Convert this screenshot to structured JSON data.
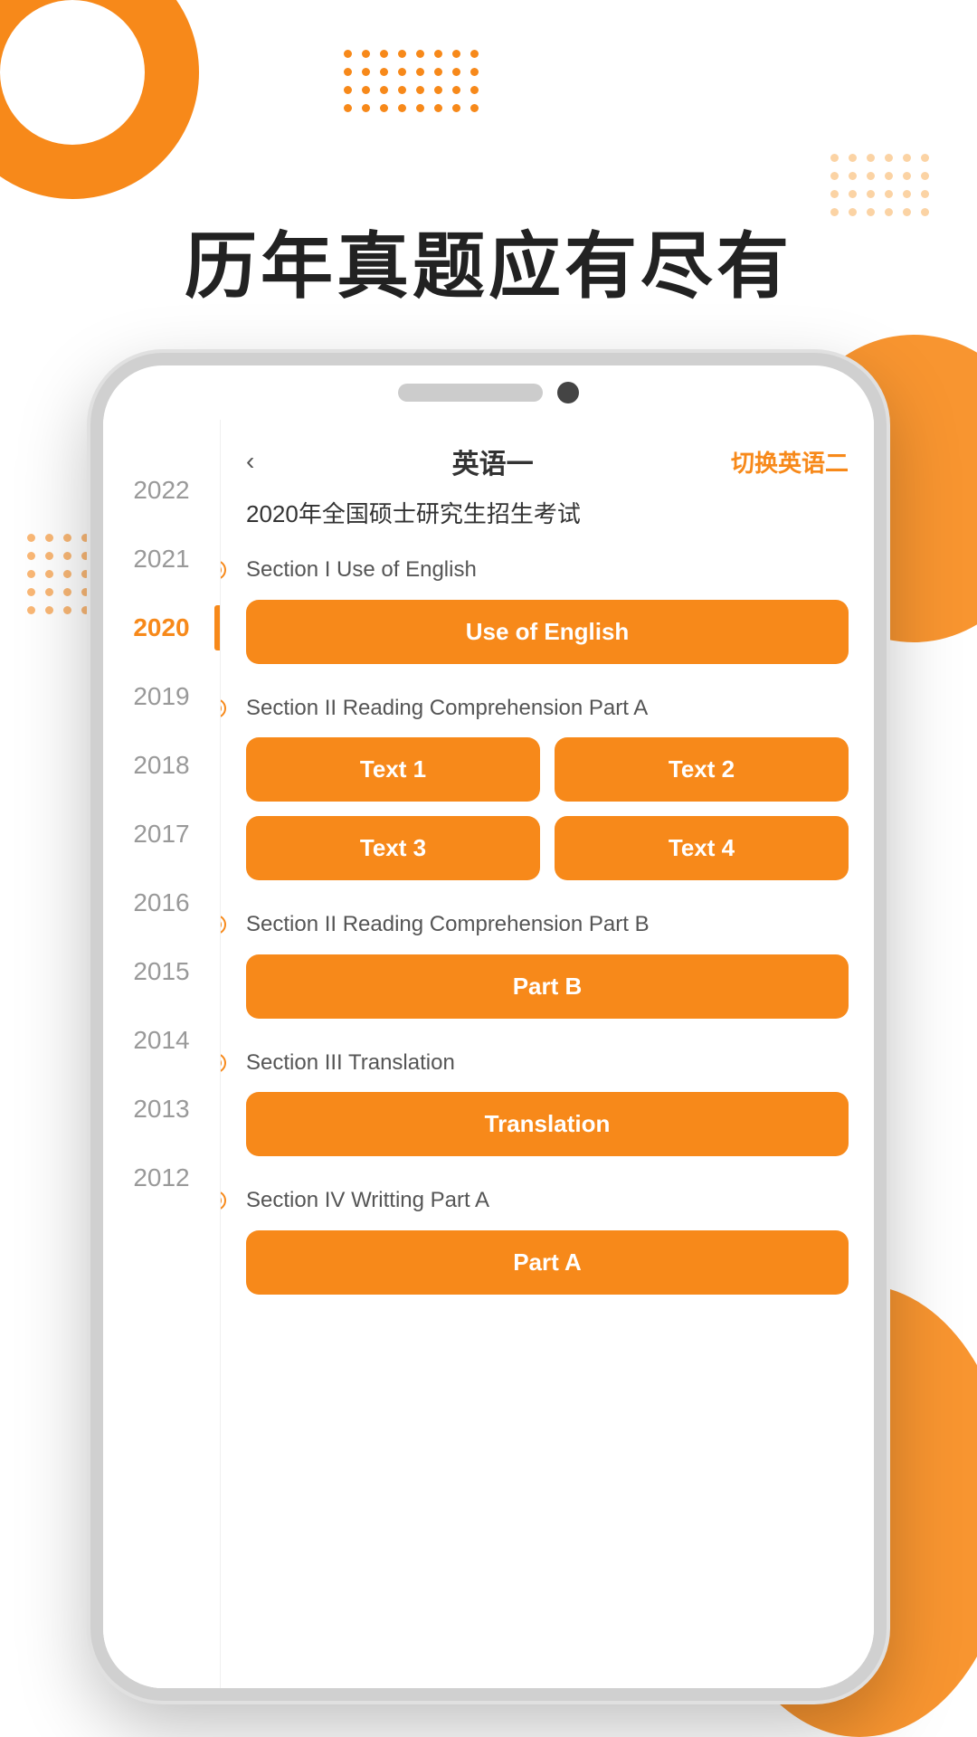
{
  "page": {
    "heading": "历年真题应有尽有"
  },
  "header": {
    "back_label": "‹",
    "lang_title": "英语一",
    "lang_switch": "切换英语二"
  },
  "exam": {
    "title": "2020年全国硕士研究生招生考试"
  },
  "years": [
    {
      "label": "2022",
      "active": false
    },
    {
      "label": "2021",
      "active": false
    },
    {
      "label": "2020",
      "active": true
    },
    {
      "label": "2019",
      "active": false
    },
    {
      "label": "2018",
      "active": false
    },
    {
      "label": "2017",
      "active": false
    },
    {
      "label": "2016",
      "active": false
    },
    {
      "label": "2015",
      "active": false
    },
    {
      "label": "2014",
      "active": false
    },
    {
      "label": "2013",
      "active": false
    },
    {
      "label": "2012",
      "active": false
    }
  ],
  "sections": [
    {
      "id": "section1",
      "label": "Section I Use of English",
      "buttons": [
        {
          "text": "Use of English"
        }
      ],
      "grid": "single"
    },
    {
      "id": "section2",
      "label": "Section II Reading Comprehension Part A",
      "buttons": [
        {
          "text": "Text 1"
        },
        {
          "text": "Text 2"
        },
        {
          "text": "Text 3"
        },
        {
          "text": "Text 4"
        }
      ],
      "grid": "double"
    },
    {
      "id": "section3",
      "label": "Section II Reading Comprehension Part B",
      "buttons": [
        {
          "text": "Part B"
        }
      ],
      "grid": "single"
    },
    {
      "id": "section4",
      "label": "Section III Translation",
      "buttons": [
        {
          "text": "Translation"
        }
      ],
      "grid": "single"
    },
    {
      "id": "section5",
      "label": "Section IV Writting Part A",
      "buttons": [
        {
          "text": "Part A"
        }
      ],
      "grid": "single"
    }
  ]
}
